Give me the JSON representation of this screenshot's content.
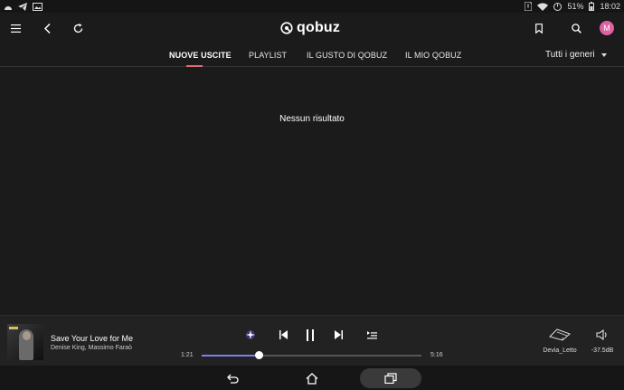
{
  "status_bar": {
    "battery": "51%",
    "time": "18:02"
  },
  "header": {
    "logo_text": "qobuz",
    "avatar_initial": "M"
  },
  "tabs": [
    {
      "label": "NUOVE USCITE",
      "active": true
    },
    {
      "label": "PLAYLIST",
      "active": false
    },
    {
      "label": "IL GUSTO DI QOBUZ",
      "active": false
    },
    {
      "label": "IL MIO QOBUZ",
      "active": false
    }
  ],
  "genre_filter": {
    "selected": "Tutti i generi"
  },
  "main": {
    "empty_message": "Nessun risultato"
  },
  "player": {
    "title": "Save Your Love for Me",
    "artist": "Denise King, Massimo Faraò",
    "elapsed": "1:21",
    "duration": "5:16",
    "progress": 0.26,
    "device": "Devia_Letto",
    "volume": "-37.5dB"
  },
  "colors": {
    "background": "#1b1b1b",
    "accent_underline": "#e06a78",
    "seek_fill": "#7c7ff0",
    "avatar": "#e061a3"
  }
}
